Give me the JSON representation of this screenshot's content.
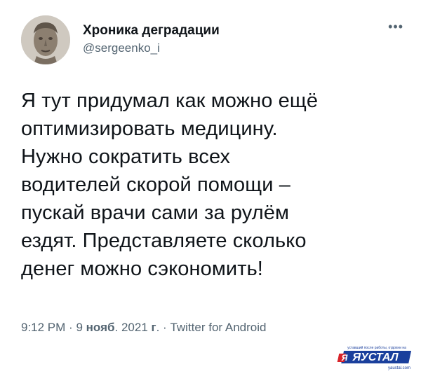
{
  "author": {
    "display_name": "Хроника деградации",
    "handle": "@sergeenko_i"
  },
  "more_icon": "more-options-icon",
  "tweet": {
    "lines": [
      "Я тут придумал как можно ещё",
      "оптимизировать медицину.",
      "Нужно сократить всех",
      "водителей скорой помощи –",
      "пускай врачи сами за рулём",
      "ездят. Представляете сколько",
      "денег можно сэкономить!"
    ]
  },
  "meta": {
    "time": "9:12 PM",
    "sep1": "·",
    "day": "9",
    "month": "нояб",
    "year": ". 2021",
    "year_suffix": "г",
    "sep2": ". ·",
    "source": "Twitter for Android"
  },
  "watermark": {
    "tagline": "уставший после работы, отдохни на",
    "logo": "ЯУСТАЛ",
    "site": "yaustal.com"
  },
  "colors": {
    "text": "#0f1419",
    "secondary": "#536471",
    "watermark_blue": "#1a3f9c",
    "watermark_red": "#d8232a"
  }
}
